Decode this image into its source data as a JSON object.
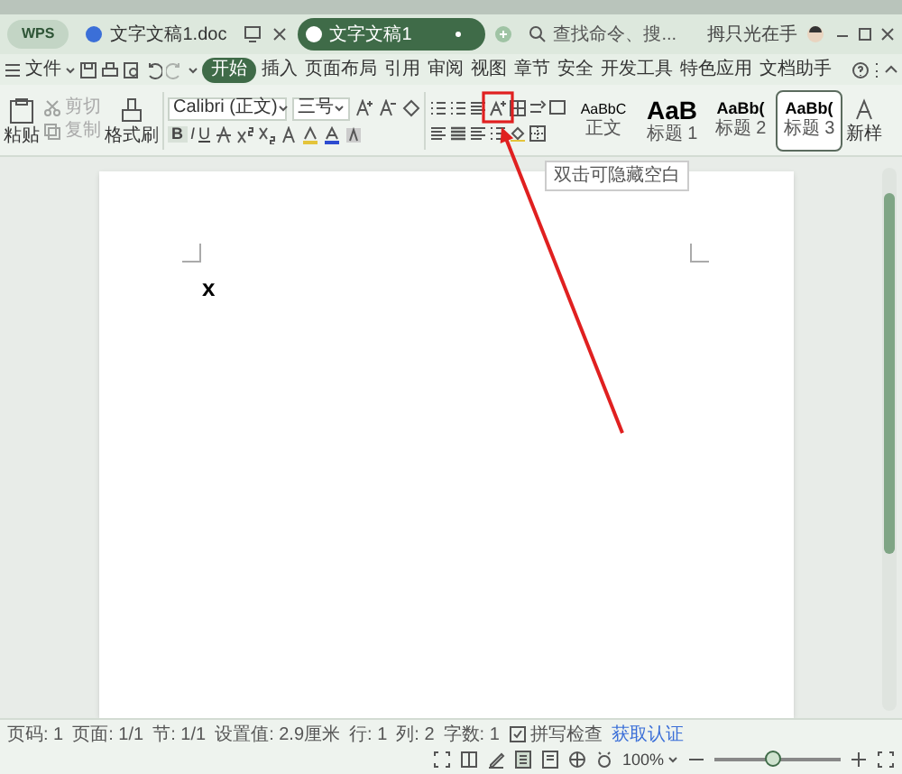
{
  "title_bar": {
    "wps_button": "WPS",
    "tabs": [
      {
        "label": "文字文稿1.doc",
        "selected": false
      },
      {
        "label": "文字文稿1",
        "selected": true
      }
    ],
    "search": {
      "placeholder": "查找命令、搜..."
    },
    "user": "拇只光在手"
  },
  "menu": {
    "file": "文件",
    "tabs": [
      {
        "label": "开始",
        "selected": true
      },
      {
        "label": "插入",
        "selected": false
      },
      {
        "label": "页面布局",
        "selected": false
      },
      {
        "label": "引用",
        "selected": false
      },
      {
        "label": "审阅",
        "selected": false
      },
      {
        "label": "视图",
        "selected": false
      },
      {
        "label": "章节",
        "selected": false
      },
      {
        "label": "安全",
        "selected": false
      },
      {
        "label": "开发工具",
        "selected": false
      },
      {
        "label": "特色应用",
        "selected": false
      },
      {
        "label": "文档助手",
        "selected": false
      }
    ]
  },
  "ribbon": {
    "paste": "粘贴",
    "clipboard": [
      {
        "label": "剪切",
        "disabled": true
      },
      {
        "label": "复制",
        "disabled": true
      }
    ],
    "format_painter": "格式刷",
    "font": "Calibri (正文)",
    "size": "三号",
    "format_buttons": [
      "B",
      "I",
      "U"
    ],
    "styles": [
      {
        "preview": "AaBbC",
        "label": "正文",
        "selected": false
      },
      {
        "preview": "AaB",
        "label": "标题 1",
        "selected": false
      },
      {
        "preview": "AaBb(",
        "label": "标题 2",
        "selected": false
      },
      {
        "preview": "AaBb(",
        "label": "标题 3",
        "selected": true
      }
    ],
    "new_style": "新样"
  },
  "tooltip": "双击可隐藏空白",
  "document": {
    "text": "x"
  },
  "status_bar": {
    "items": [
      "页码: 1",
      "页面: 1/1",
      "节: 1/1",
      "设置值: 2.9厘米",
      "行: 1",
      "列: 2",
      "字数: 1"
    ],
    "spell_check": "拼写检查",
    "certify": "获取认证",
    "zoom": "100%",
    "zoom_level": {
      "level": 0.46
    }
  }
}
